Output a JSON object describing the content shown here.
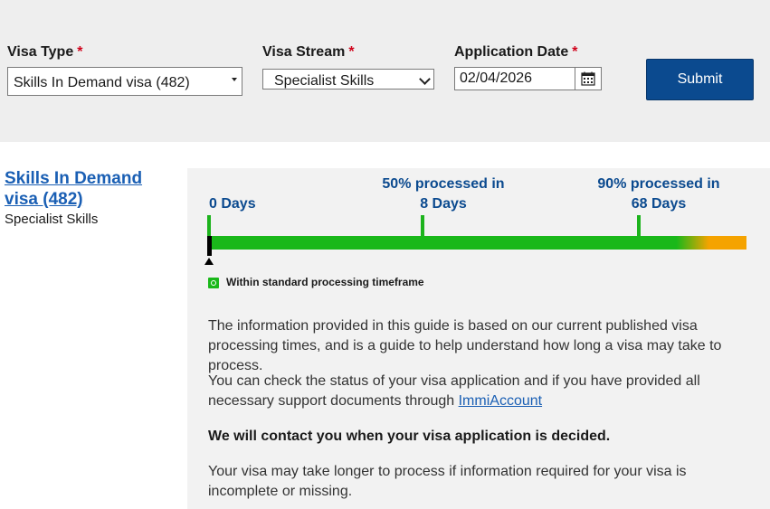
{
  "form": {
    "visa_type": {
      "label": "Visa Type",
      "required_mark": "*",
      "value": "Skills In Demand visa (482)"
    },
    "visa_stream": {
      "label": "Visa Stream",
      "required_mark": "*",
      "value": "Specialist Skills"
    },
    "application_date": {
      "label": "Application Date",
      "required_mark": "*",
      "value": "02/04/2026"
    },
    "submit_label": "Submit"
  },
  "result": {
    "visa_title": "Skills In Demand visa (482)",
    "visa_stream": "Specialist Skills",
    "timeline": {
      "start": {
        "line1": "",
        "line2": "0 Days"
      },
      "mid": {
        "line1": "50% processed in",
        "line2": "8 Days"
      },
      "end": {
        "line1": "90% processed in",
        "line2": "68 Days"
      }
    },
    "status_text": "Within standard processing timeframe",
    "para1": "The information provided in this guide is based on our current published visa processing times, and is a guide to help understand how long a visa may take to process.",
    "para2_text": "You can check the status of your visa application and if you have provided all necessary support documents through ",
    "para2_link": "ImmiAccount",
    "para3": "We will contact you when your visa application is decided.",
    "para4": "Your visa may take longer to process if information required for your visa is incomplete or missing."
  },
  "colors": {
    "accent": "#0b4a8f",
    "link": "#1a5fb4",
    "bar_green": "#1ab81a",
    "bar_orange": "#f5a300",
    "required": "#d0021b"
  }
}
